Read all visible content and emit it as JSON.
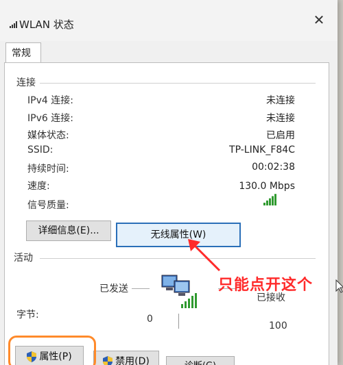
{
  "window": {
    "title": "WLAN 状态",
    "close_glyph": "✕"
  },
  "tabs": [
    {
      "label": "常规"
    }
  ],
  "connection": {
    "section_label": "连接",
    "rows": [
      {
        "label": "IPv4 连接:",
        "value": "未连接"
      },
      {
        "label": "IPv6 连接:",
        "value": "未连接"
      },
      {
        "label": "媒体状态:",
        "value": "已启用"
      },
      {
        "label": "SSID:",
        "value": "TP-LINK_F84C"
      },
      {
        "label": "持续时间:",
        "value": "00:02:38"
      },
      {
        "label": "速度:",
        "value": "130.0 Mbps"
      }
    ],
    "signal_label": "信号质量:",
    "signal_bars": 5,
    "signal_bars_total": 5
  },
  "buttons": {
    "details": "详细信息(E)...",
    "wireless_properties": "无线属性(W)"
  },
  "activity": {
    "section_label": "活动",
    "sent_label": "已发送",
    "received_label": "已接收",
    "bytes_label": "字节:",
    "sent_value": "0",
    "received_value": "100"
  },
  "bottom_buttons": {
    "properties": "属性(P)",
    "disable": "禁用(D)",
    "diagnose": "诊断(G)"
  },
  "annotation": {
    "text": "只能点开这个"
  },
  "colors": {
    "accent_border": "#2a6fb8",
    "annotation": "#ff2a2a",
    "highlight": "#ff8a2a",
    "signal": "#2f9a2f"
  },
  "icons": {
    "wlan": "wifi-signal-icon",
    "network": "network-computers-icon",
    "shield": "uac-shield-icon"
  }
}
